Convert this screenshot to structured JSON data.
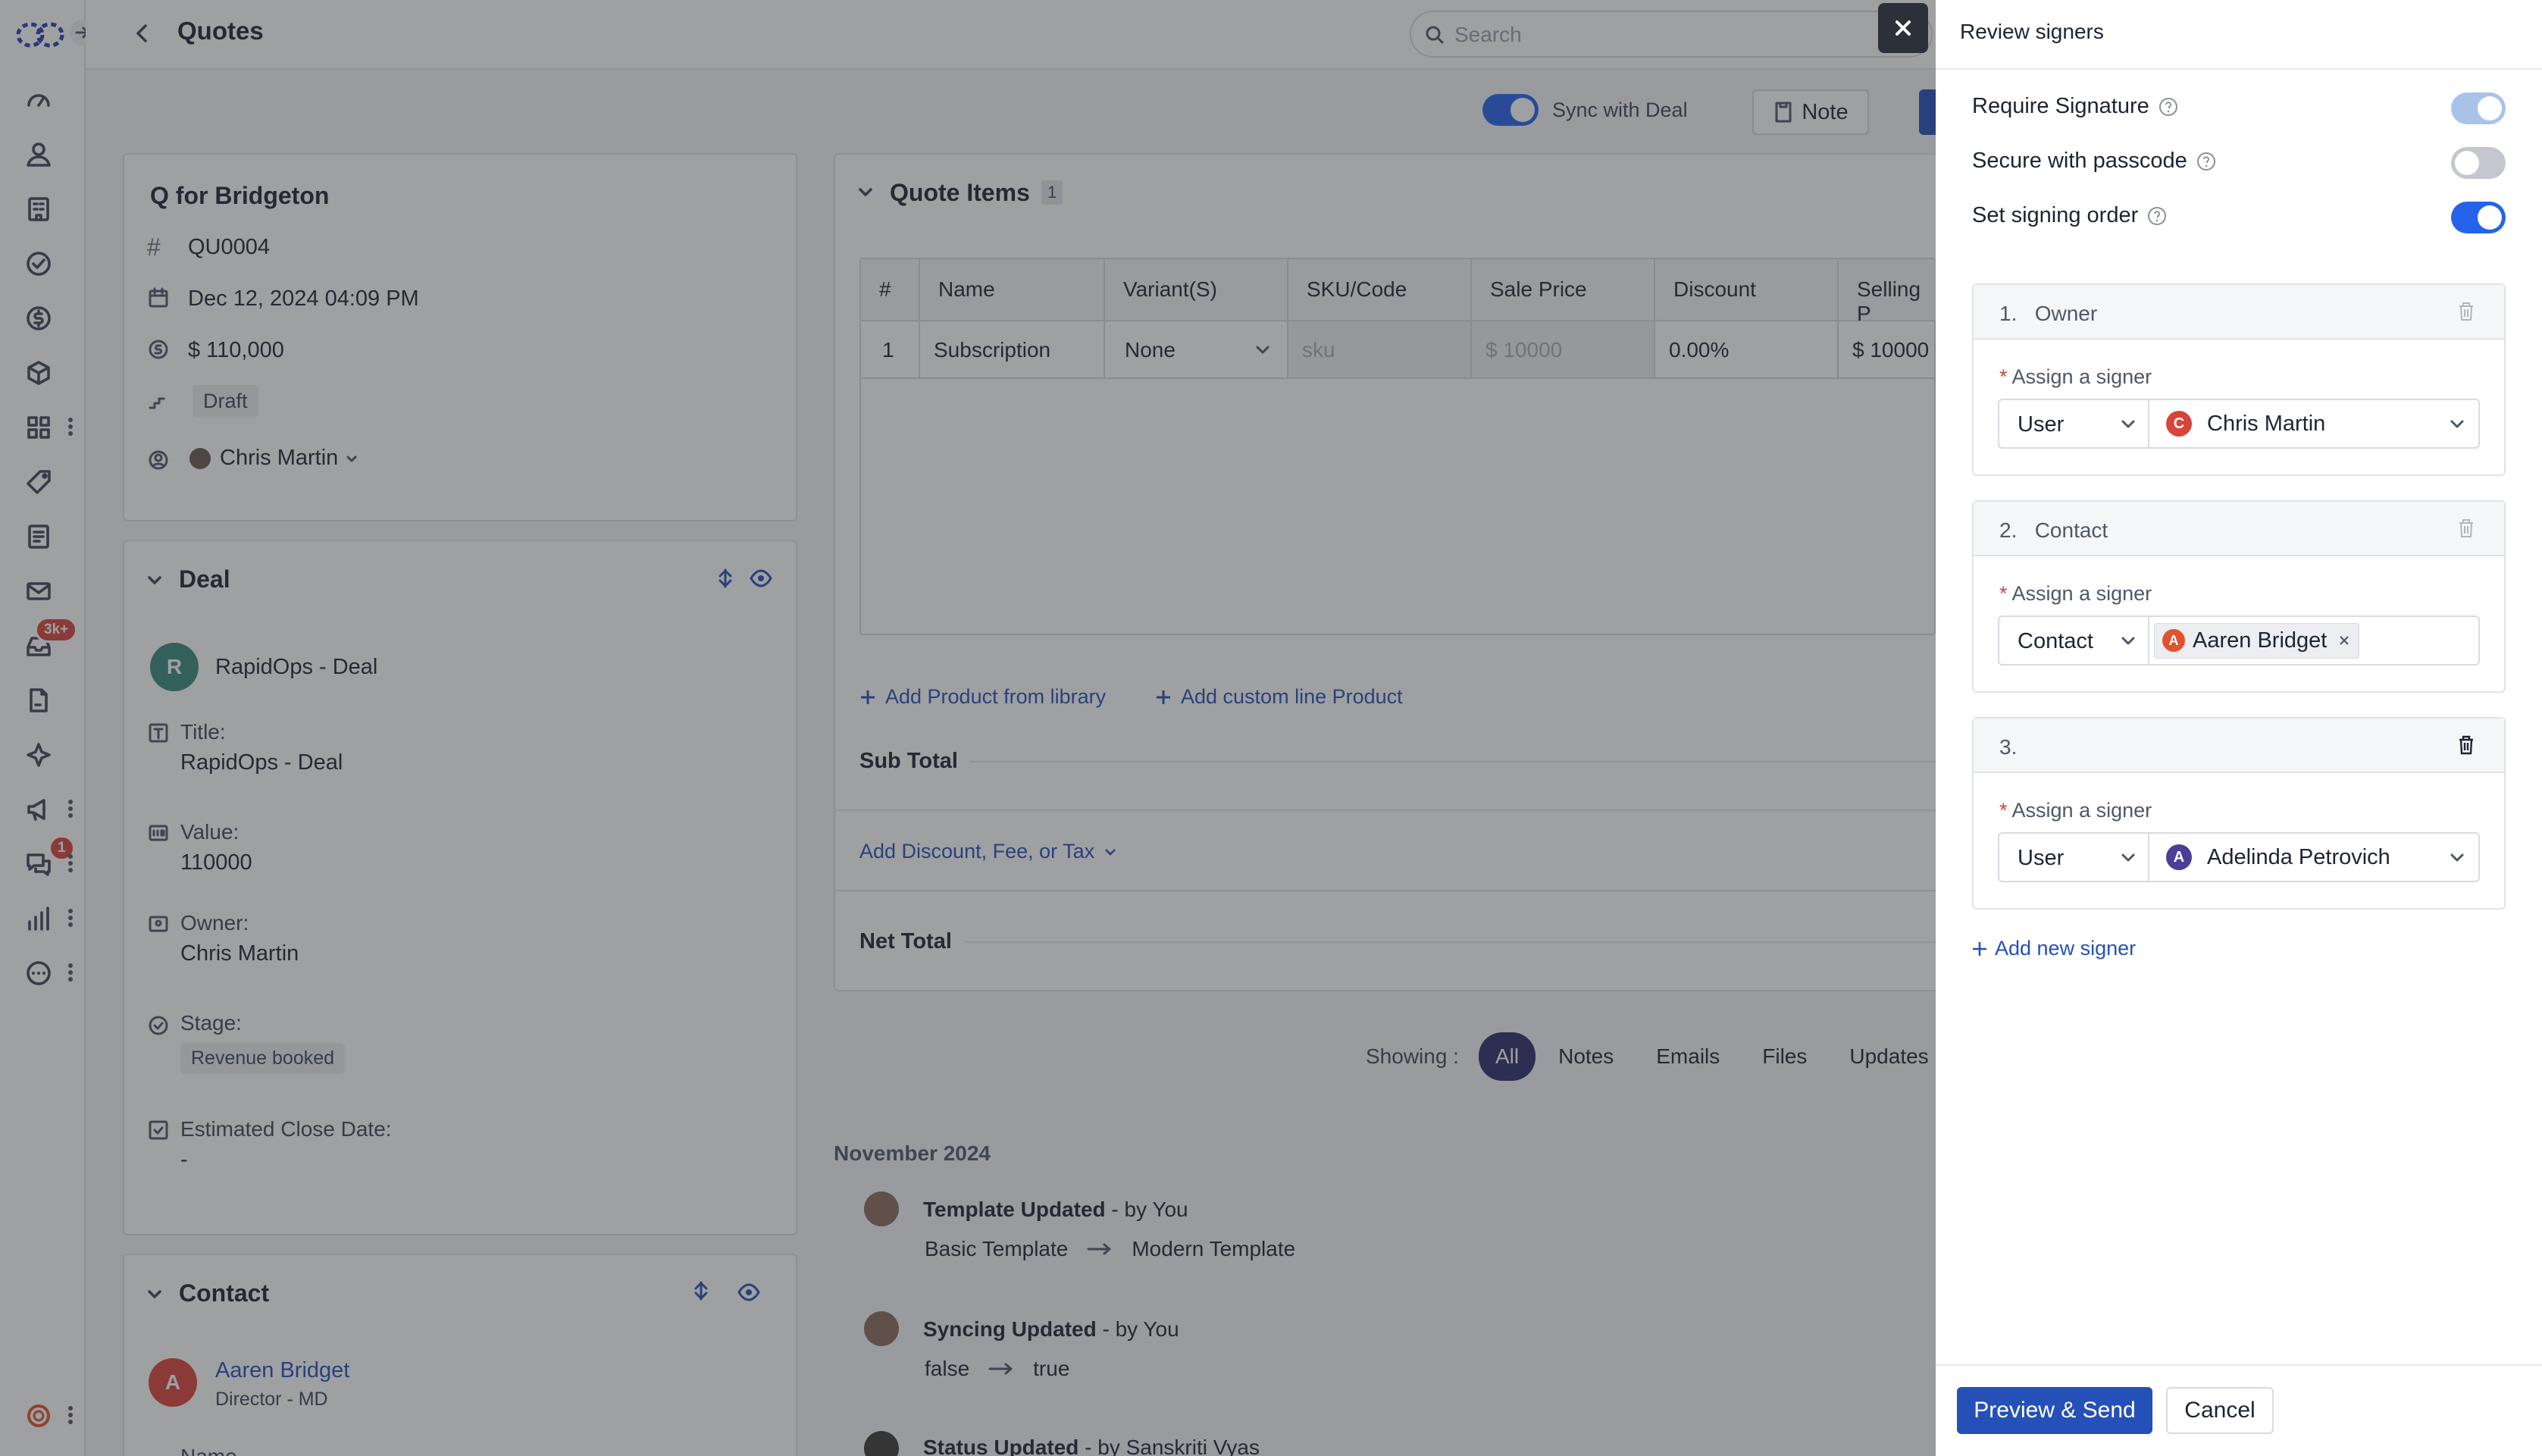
{
  "header": {
    "title": "Quotes",
    "search_placeholder": "Search"
  },
  "sidebar": {
    "badges": {
      "inbox": "3k+",
      "chat": "1"
    }
  },
  "toolbar": {
    "sync_label": "Sync with Deal",
    "note_label": "Note"
  },
  "quote": {
    "title": "Q for Bridgeton",
    "number": "QU0004",
    "date": "Dec 12, 2024 04:09 PM",
    "amount": "$ 110,000",
    "status": "Draft",
    "owner": "Chris Martin"
  },
  "deal": {
    "heading": "Deal",
    "avatar": "R",
    "name": "RapidOps - Deal",
    "title_label": "Title:",
    "title_value": "RapidOps - Deal",
    "value_label": "Value:",
    "value_value": "110000",
    "owner_label": "Owner:",
    "owner_value": "Chris Martin",
    "stage_label": "Stage:",
    "stage_value": "Revenue booked",
    "close_label": "Estimated Close Date:",
    "close_value": "-"
  },
  "contact": {
    "heading": "Contact",
    "avatar": "A",
    "name": "Aaren Bridget",
    "role": "Director - MD",
    "next_label": "Name"
  },
  "quote_items": {
    "heading": "Quote Items",
    "count": "1",
    "columns": [
      "#",
      "Name",
      "Variant(S)",
      "SKU/Code",
      "Sale Price",
      "Discount",
      "Selling P"
    ],
    "rows": [
      {
        "num": "1",
        "name": "Subscription",
        "variant": "None",
        "sku": "sku",
        "sale_price": "$ 10000",
        "discount": "0.00%",
        "selling": "$ 10000"
      }
    ],
    "add_library": "Add Product from library",
    "add_custom": "Add custom line Product",
    "subtotal_label": "Sub Total",
    "discount_link": "Add Discount, Fee, or Tax",
    "net_total_label": "Net Total"
  },
  "activity": {
    "showing_label": "Showing :",
    "filters": [
      "All",
      "Notes",
      "Emails",
      "Files",
      "Updates"
    ],
    "month": "November 2024",
    "items": [
      {
        "title": "Template Updated",
        "by": "- by You",
        "from": "Basic Template",
        "to": "Modern Template"
      },
      {
        "title": "Syncing Updated",
        "by": "- by You",
        "from": "false",
        "to": "true"
      },
      {
        "title": "Status Updated",
        "by": "- by Sanskriti Vyas"
      }
    ]
  },
  "drawer": {
    "title": "Review signers",
    "options": [
      {
        "label": "Require Signature",
        "on": true,
        "disabled": true
      },
      {
        "label": "Secure with passcode",
        "on": false
      },
      {
        "label": "Set signing order",
        "on": true
      }
    ],
    "assign_label": "Assign a signer",
    "signers": [
      {
        "index": "1.",
        "role": "Owner",
        "type": "User",
        "name": "Chris Martin",
        "initial": "C",
        "color": "#d8433a"
      },
      {
        "index": "2.",
        "role": "Contact",
        "type": "Contact",
        "name": "Aaren Bridget",
        "initial": "A",
        "color": "#e0532f"
      },
      {
        "index": "3.",
        "role": "",
        "type": "User",
        "name": "Adelinda Petrovich",
        "initial": "A",
        "color": "#4b3d98"
      }
    ],
    "add_signer": "Add new signer",
    "preview_button": "Preview & Send",
    "cancel_button": "Cancel"
  },
  "colors": {
    "primary": "#2550b8",
    "toggle_on": "#2563eb",
    "overlay": "rgba(45,47,52,0.46)",
    "accent_dark": "#2b2f6b"
  }
}
